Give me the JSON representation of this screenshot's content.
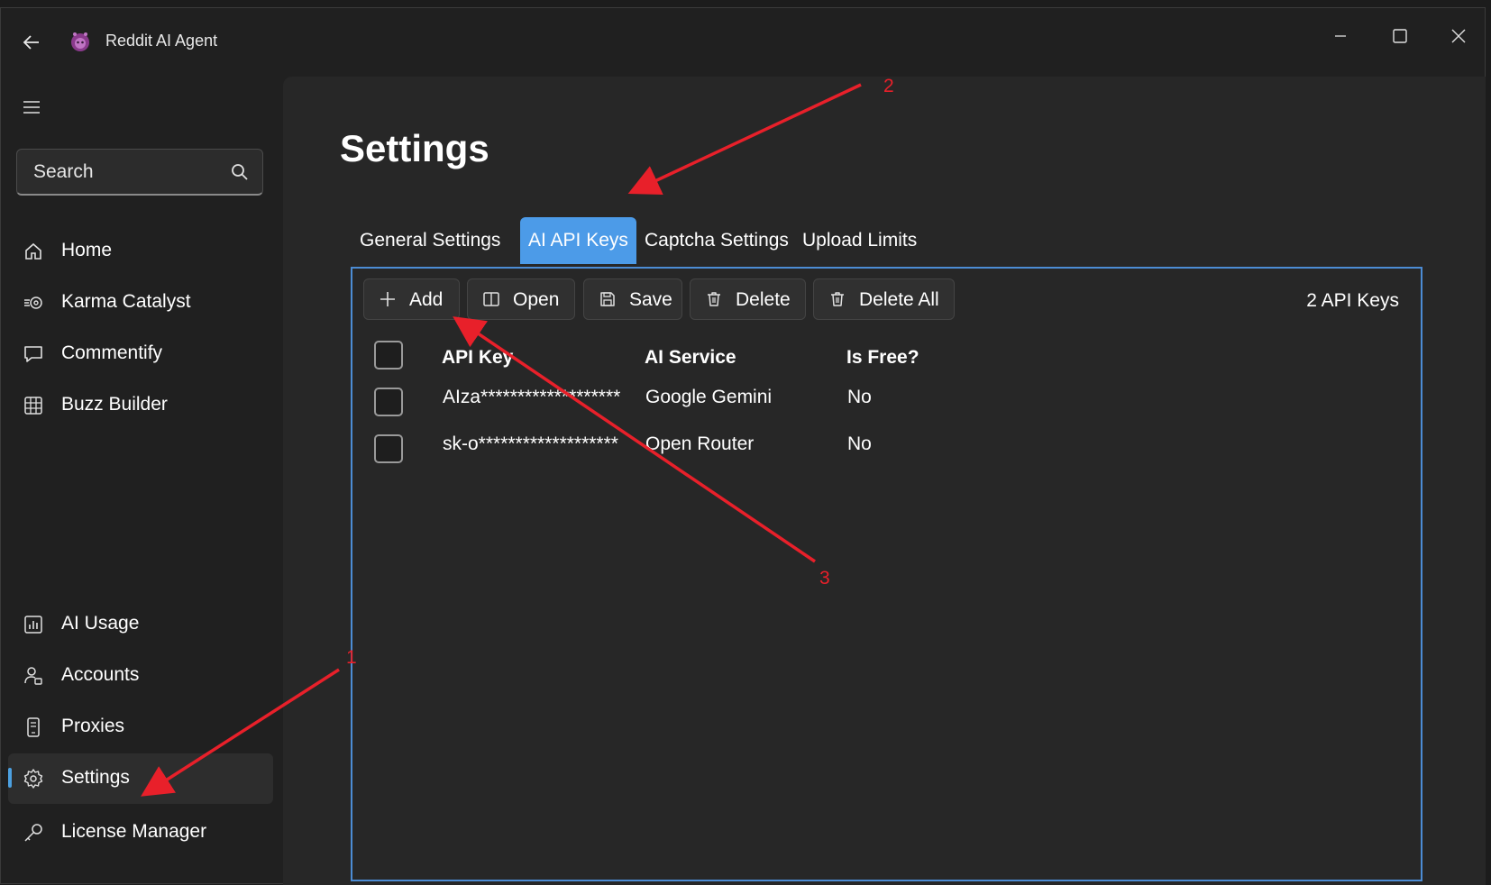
{
  "window": {
    "title": "Reddit AI Agent"
  },
  "sidebar": {
    "search_placeholder": "Search",
    "items": [
      {
        "label": "Home",
        "icon": "home-icon"
      },
      {
        "label": "Karma Catalyst",
        "icon": "karma-icon"
      },
      {
        "label": "Commentify",
        "icon": "comment-icon"
      },
      {
        "label": "Buzz Builder",
        "icon": "grid-icon"
      }
    ],
    "bottom_items": [
      {
        "label": "AI Usage",
        "icon": "chart-icon"
      },
      {
        "label": "Accounts",
        "icon": "user-icon"
      },
      {
        "label": "Proxies",
        "icon": "phone-icon"
      },
      {
        "label": "Settings",
        "icon": "gear-icon",
        "active": true
      },
      {
        "label": "License Manager",
        "icon": "key-icon"
      }
    ]
  },
  "main": {
    "title": "Settings",
    "tabs": [
      {
        "label": "General Settings"
      },
      {
        "label": "AI API Keys",
        "active": true
      },
      {
        "label": "Captcha Settings"
      },
      {
        "label": "Upload Limits"
      }
    ],
    "toolbar": {
      "add_label": "Add",
      "open_label": "Open",
      "save_label": "Save",
      "delete_label": "Delete",
      "delete_all_label": "Delete All",
      "count_label": "2 API Keys"
    },
    "table": {
      "columns": [
        "API Key",
        "AI Service",
        "Is Free?"
      ],
      "rows": [
        {
          "api_key": "AIza*******************",
          "service": "Google Gemini",
          "is_free": "No"
        },
        {
          "api_key": "sk-o*******************",
          "service": "Open Router",
          "is_free": "No"
        }
      ]
    }
  },
  "annotations": {
    "labels": [
      "1",
      "2",
      "3"
    ],
    "color": "#e8202a"
  },
  "colors": {
    "accent": "#4c9be8",
    "panel_border": "#4c8cd4",
    "background": "#202020"
  }
}
